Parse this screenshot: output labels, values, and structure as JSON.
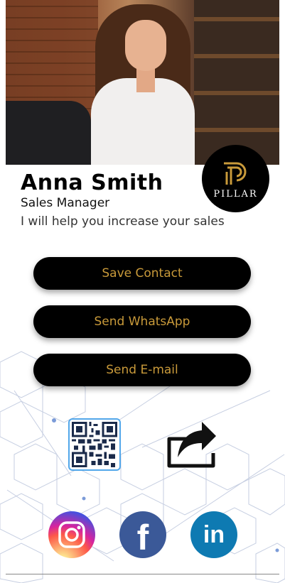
{
  "profile": {
    "name": "Anna Smith",
    "role": "Sales Manager",
    "tagline": "I will help you increase your sales"
  },
  "logo": {
    "text": "PILLAR"
  },
  "actions": {
    "save_contact": "Save Contact",
    "send_whatsapp": "Send WhatsApp",
    "send_email": "Send E-mail"
  },
  "icons": {
    "qr": "qr-code-icon",
    "share": "share-icon",
    "instagram": "instagram-icon",
    "facebook": "facebook-icon",
    "linkedin": "linkedin-icon"
  },
  "colors": {
    "button_bg": "#000000",
    "button_text": "#c99a3a",
    "qr_border": "#52a7ea",
    "facebook": "#3b5998",
    "linkedin": "#0e7ab2"
  }
}
